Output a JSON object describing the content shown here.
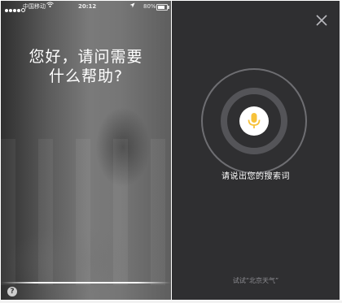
{
  "status_bar": {
    "carrier": "中国移动",
    "time": "20:12",
    "battery": "80%"
  },
  "siri": {
    "greeting_line1": "您好，请问需要",
    "greeting_line2": "什么帮助?",
    "help_label": "?"
  },
  "voice_search": {
    "prompt": "请说出您的搜索词",
    "hint": "试试“北京天气”",
    "mic_color": "#f7c23a",
    "bg_color": "#2f2f31"
  }
}
